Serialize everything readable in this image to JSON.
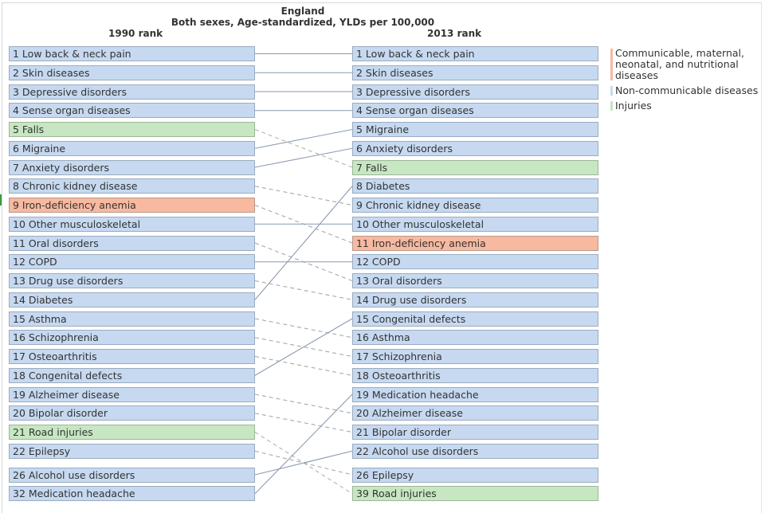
{
  "chart_data": {
    "type": "slope-rank",
    "title": "England",
    "subtitle": "Both sexes, Age-standardized, YLDs per 100,000",
    "left_header": "1990 rank",
    "right_header": "2013 rank",
    "categories": {
      "comm": {
        "label": "Communicable, maternal, neonatal, and nutritional diseases",
        "color": "#f7b9a0"
      },
      "ncd": {
        "label": "Non-communicable diseases",
        "color": "#c6d9f0"
      },
      "inj": {
        "label": "Injuries",
        "color": "#c6e7c1"
      }
    },
    "left": [
      {
        "rank": 1,
        "cause": "Low back & neck pain",
        "cat": "ncd"
      },
      {
        "rank": 2,
        "cause": "Skin diseases",
        "cat": "ncd"
      },
      {
        "rank": 3,
        "cause": "Depressive disorders",
        "cat": "ncd"
      },
      {
        "rank": 4,
        "cause": "Sense organ diseases",
        "cat": "ncd"
      },
      {
        "rank": 5,
        "cause": "Falls",
        "cat": "inj"
      },
      {
        "rank": 6,
        "cause": "Migraine",
        "cat": "ncd"
      },
      {
        "rank": 7,
        "cause": "Anxiety disorders",
        "cat": "ncd"
      },
      {
        "rank": 8,
        "cause": "Chronic kidney disease",
        "cat": "ncd"
      },
      {
        "rank": 9,
        "cause": "Iron-deficiency anemia",
        "cat": "comm"
      },
      {
        "rank": 10,
        "cause": "Other musculoskeletal",
        "cat": "ncd"
      },
      {
        "rank": 11,
        "cause": "Oral disorders",
        "cat": "ncd"
      },
      {
        "rank": 12,
        "cause": "COPD",
        "cat": "ncd"
      },
      {
        "rank": 13,
        "cause": "Drug use disorders",
        "cat": "ncd"
      },
      {
        "rank": 14,
        "cause": "Diabetes",
        "cat": "ncd"
      },
      {
        "rank": 15,
        "cause": "Asthma",
        "cat": "ncd"
      },
      {
        "rank": 16,
        "cause": "Schizophrenia",
        "cat": "ncd"
      },
      {
        "rank": 17,
        "cause": "Osteoarthritis",
        "cat": "ncd"
      },
      {
        "rank": 18,
        "cause": "Congenital defects",
        "cat": "ncd"
      },
      {
        "rank": 19,
        "cause": "Alzheimer disease",
        "cat": "ncd"
      },
      {
        "rank": 20,
        "cause": "Bipolar disorder",
        "cat": "ncd"
      },
      {
        "rank": 21,
        "cause": "Road injuries",
        "cat": "inj"
      },
      {
        "rank": 22,
        "cause": "Epilepsy",
        "cat": "ncd"
      },
      {
        "rank": 26,
        "cause": "Alcohol use disorders",
        "cat": "ncd"
      },
      {
        "rank": 32,
        "cause": "Medication headache",
        "cat": "ncd"
      }
    ],
    "right": [
      {
        "rank": 1,
        "cause": "Low back & neck pain",
        "cat": "ncd"
      },
      {
        "rank": 2,
        "cause": "Skin diseases",
        "cat": "ncd"
      },
      {
        "rank": 3,
        "cause": "Depressive disorders",
        "cat": "ncd"
      },
      {
        "rank": 4,
        "cause": "Sense organ diseases",
        "cat": "ncd"
      },
      {
        "rank": 5,
        "cause": "Migraine",
        "cat": "ncd"
      },
      {
        "rank": 6,
        "cause": "Anxiety disorders",
        "cat": "ncd"
      },
      {
        "rank": 7,
        "cause": "Falls",
        "cat": "inj"
      },
      {
        "rank": 8,
        "cause": "Diabetes",
        "cat": "ncd"
      },
      {
        "rank": 9,
        "cause": "Chronic kidney disease",
        "cat": "ncd"
      },
      {
        "rank": 10,
        "cause": "Other musculoskeletal",
        "cat": "ncd"
      },
      {
        "rank": 11,
        "cause": "Iron-deficiency anemia",
        "cat": "comm"
      },
      {
        "rank": 12,
        "cause": "COPD",
        "cat": "ncd"
      },
      {
        "rank": 13,
        "cause": "Oral disorders",
        "cat": "ncd"
      },
      {
        "rank": 14,
        "cause": "Drug use disorders",
        "cat": "ncd"
      },
      {
        "rank": 15,
        "cause": "Congenital defects",
        "cat": "ncd"
      },
      {
        "rank": 16,
        "cause": "Asthma",
        "cat": "ncd"
      },
      {
        "rank": 17,
        "cause": "Schizophrenia",
        "cat": "ncd"
      },
      {
        "rank": 18,
        "cause": "Osteoarthritis",
        "cat": "ncd"
      },
      {
        "rank": 19,
        "cause": "Medication headache",
        "cat": "ncd"
      },
      {
        "rank": 20,
        "cause": "Alzheimer disease",
        "cat": "ncd"
      },
      {
        "rank": 21,
        "cause": "Bipolar disorder",
        "cat": "ncd"
      },
      {
        "rank": 22,
        "cause": "Alcohol use disorders",
        "cat": "ncd"
      },
      {
        "rank": 26,
        "cause": "Epilepsy",
        "cat": "ncd"
      },
      {
        "rank": 39,
        "cause": "Road injuries",
        "cat": "inj"
      }
    ],
    "line_styles": {
      "rank_up": "solid",
      "rank_same": "solid",
      "rank_down": "dashed"
    }
  },
  "legend": [
    {
      "key": "comm",
      "label": "Communicable, maternal, neonatal, and nutritional diseases",
      "color": "#f7b9a0"
    },
    {
      "key": "ncd",
      "label": "Non-communicable diseases",
      "color": "#c6d9f0"
    },
    {
      "key": "inj",
      "label": "Injuries",
      "color": "#c6e7c1"
    }
  ]
}
